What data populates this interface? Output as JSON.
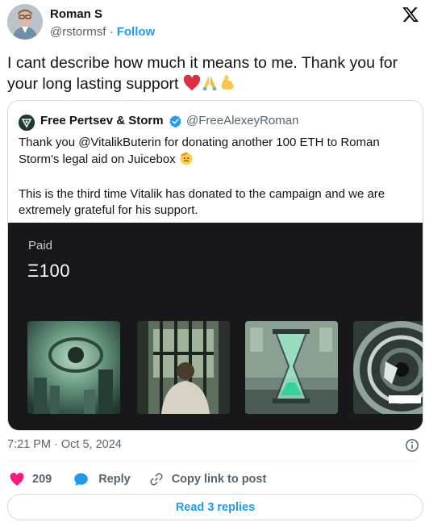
{
  "author": {
    "name": "Roman S",
    "handle": "@rstormsf",
    "separator": "·",
    "follow_label": "Follow",
    "avatar_icon": "profile-photo"
  },
  "platform_icon": "x-logo-icon",
  "tweet": {
    "text": "I cant describe how much it means to me. Thank you for your long lasting support",
    "emojis": [
      "red-heart",
      "folded-hands",
      "flexed-biceps"
    ]
  },
  "quote": {
    "author_name": "Free Pertsev & Storm",
    "verified": true,
    "handle": "@FreeAlexeyRoman",
    "paragraph_1": "Thank you @VitalikButerin for donating another 100 ETH to Roman Storm's legal aid on Juicebox",
    "paragraph_1_emoji": "saluting-face",
    "paragraph_2": "This is the third time Vitalik has donated to the campaign and we are extremely grateful for his support.",
    "media": {
      "paid_label": "Paid",
      "paid_amount": "Ξ100",
      "thumbnails": [
        "green-eye-city-art",
        "man-behind-bars-art",
        "hourglass-room-art",
        "defend-roman-storm-vortex-art"
      ]
    }
  },
  "timestamp": "7:21 PM · Oct 5, 2024",
  "actions": {
    "like_count": "209",
    "reply_label": "Reply",
    "copy_label": "Copy link to post"
  },
  "read_replies_label": "Read 3 replies",
  "colors": {
    "accent": "#1d9bf0",
    "like": "#f91880",
    "text": "#0f1419",
    "muted": "#536471",
    "media_bg": "#17171c"
  }
}
